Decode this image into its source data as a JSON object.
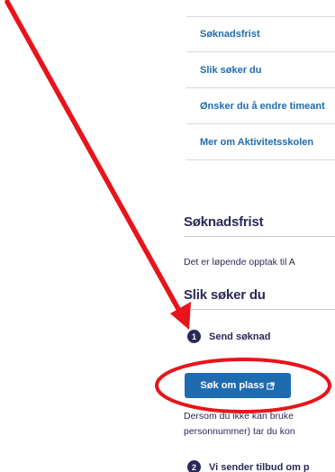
{
  "nav": {
    "items": [
      {
        "label": "Søknadsfrist"
      },
      {
        "label": "Slik søker du"
      },
      {
        "label": "Ønsker du å endre timeant"
      },
      {
        "label": "Mer om Aktivitetsskolen"
      }
    ]
  },
  "sections": {
    "deadline_heading": "Søknadsfrist",
    "deadline_text": "Det er løpende opptak til A",
    "apply_heading": "Slik søker du"
  },
  "steps": [
    {
      "number": "1",
      "label": "Send søknad"
    },
    {
      "number": "2",
      "label": "Vi sender tilbud om p"
    }
  ],
  "apply_button": {
    "label": "Søk om plass"
  },
  "apply_text": {
    "line1": "Dersom du ikke kan bruke",
    "line2": "personnummer) tar du kon"
  },
  "colors": {
    "link": "#1f6bb0",
    "heading": "#2a2859",
    "annotation": "#e8141a"
  }
}
